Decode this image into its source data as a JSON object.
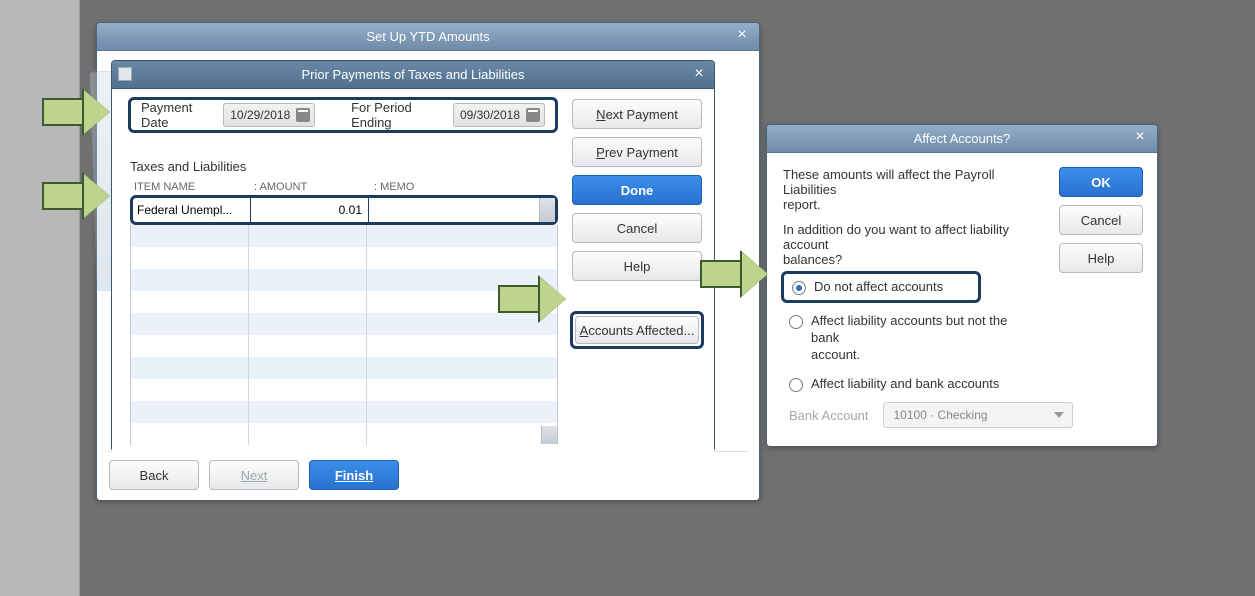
{
  "outerWindow": {
    "title": "Set Up YTD Amounts",
    "footer": {
      "back": "Back",
      "next": "Next",
      "finish": "Finish"
    }
  },
  "dialog": {
    "title": "Prior Payments of Taxes and Liabilities",
    "paymentDateLabel": "Payment Date",
    "paymentDate": "10/29/2018",
    "periodLabel": "For Period Ending",
    "periodDate": "09/30/2018",
    "sectionLabel": "Taxes and Liabilities",
    "columns": {
      "item": "ITEM NAME",
      "amount": "AMOUNT",
      "memo": "MEMO"
    },
    "row": {
      "item": "Federal Unempl...",
      "amount": "0.01",
      "memo": ""
    },
    "buttons": {
      "nextPayment": "Next Payment",
      "prevPayment": "Prev Payment",
      "done": "Done",
      "cancel": "Cancel",
      "help": "Help",
      "accountsAffected": "Accounts Affected..."
    }
  },
  "affect": {
    "title": "Affect Accounts?",
    "text1a": "These amounts will affect the Payroll Liabilities",
    "text1b": "report.",
    "text2a": "In addition do you want to affect liability account",
    "text2b": "balances?",
    "opt1": "Do not affect accounts",
    "opt2a": "Affect liability accounts but not the bank",
    "opt2b": "account.",
    "opt3": "Affect liability and bank accounts",
    "bankLabel": "Bank Account",
    "bankValue": "10100 · Checking",
    "ok": "OK",
    "cancel": "Cancel",
    "help": "Help"
  }
}
